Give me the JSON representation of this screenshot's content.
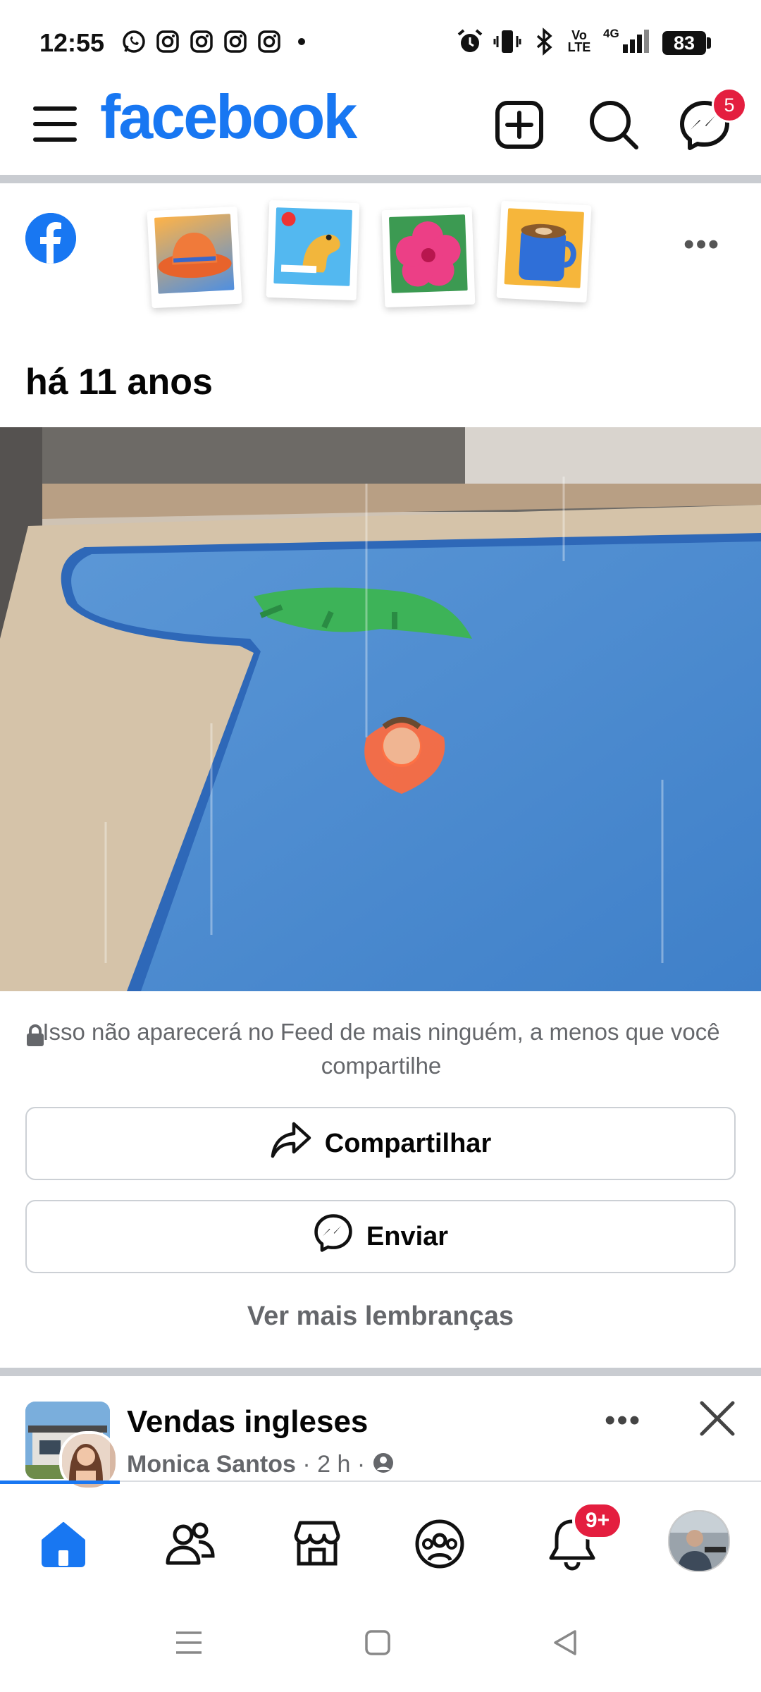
{
  "status_bar": {
    "time": "12:55",
    "battery": "83",
    "icons": [
      "whatsapp-icon",
      "instagram-icon",
      "instagram-icon",
      "instagram-icon",
      "instagram-icon",
      "dot-icon",
      "alarm-icon",
      "vibrate-icon",
      "bluetooth-icon",
      "volte-icon",
      "4g-signal-icon",
      "battery-icon"
    ],
    "network_label_1": "Vo",
    "network_label_2": "LTE",
    "data_label": "4G"
  },
  "header": {
    "logo": "facebook",
    "messenger_badge": "5",
    "brand_color": "#1877f2"
  },
  "memory": {
    "title": "há 11 anos",
    "privacy_text": "Isso não aparecerá no Feed de mais ninguém, a menos que você compartilhe",
    "share_label": "Compartilhar",
    "send_label": "Enviar",
    "more_label": "Ver mais lembranças"
  },
  "post_preview": {
    "group_name": "Vendas ingleses",
    "author": "Monica Santos",
    "time": "2 h",
    "separator": "·"
  },
  "bottom_nav": {
    "notifications_badge": "9+",
    "items": [
      "home-icon",
      "friends-icon",
      "marketplace-icon",
      "groups-icon",
      "notifications-icon",
      "profile-avatar"
    ]
  },
  "colors": {
    "accent": "#1877f2",
    "badge": "#e41e3f",
    "muted": "#65676b"
  }
}
